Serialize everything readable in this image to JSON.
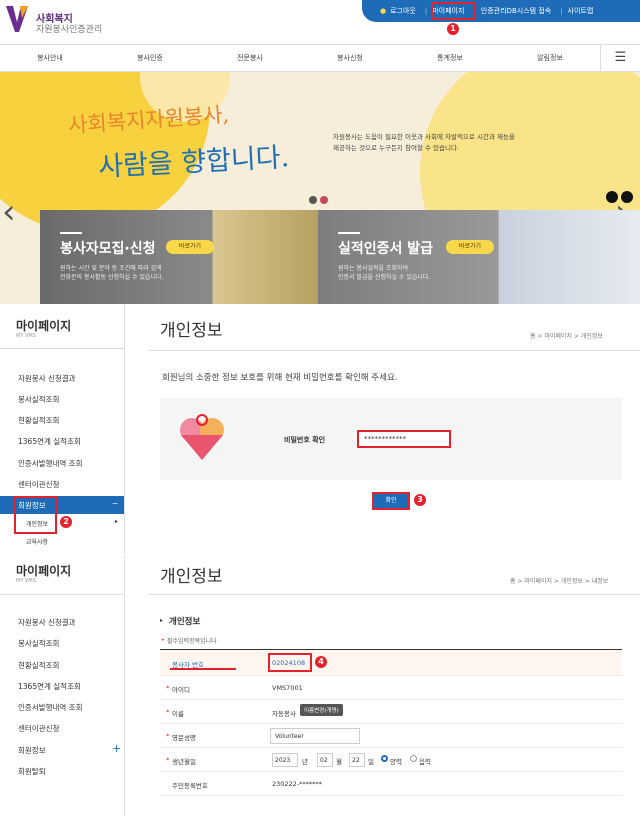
{
  "header": {
    "logo_line1": "사회복지",
    "logo_line2": "자원봉사인증관리",
    "util_links": {
      "logout": "로그아웃",
      "mypage": "마이페이지",
      "db": "인증관리DB시스템 접속",
      "sitemap": "사이트맵"
    }
  },
  "gnb": [
    "봉사안내",
    "봉사인증",
    "전문봉사",
    "봉사신청",
    "통계정보",
    "알림정보"
  ],
  "banner": {
    "title1": "사회복지자원봉사,",
    "title2": "사람을 향합니다.",
    "desc1": "자원봉사는 도움이 필요한 이웃과 사회에 자발적으로 시간과 재능을",
    "desc2": "제공하는 것으로 누구든지 참여할 수 있습니다."
  },
  "cards": [
    {
      "title": "봉사자모집·신청",
      "go": "바로가기",
      "desc1": "원하는 시간 및 분야 등 조건에 따라 검색",
      "desc2": "전화문의 봉사활동 신청하실 수 있습니다."
    },
    {
      "title": "실적인증서 발급",
      "go": "바로가기",
      "desc1": "원하는 봉사실적을 조회하여",
      "desc2": "인증서 발급을 신청하실 수 있습니다."
    }
  ],
  "section1": {
    "lnb_title": "마이페이지",
    "lnb_sub": "MY VMS",
    "lnb_items": [
      "자원봉사 신청결과",
      "봉사실적조회",
      "현황실적조회",
      "1365연계 실적조회",
      "인증서발행내역 조회",
      "센터이관신청",
      "회원정보"
    ],
    "lnb_active_minus": "−",
    "lnb_sub_items": [
      "개인정보",
      "교육사항"
    ],
    "page_title": "개인정보",
    "crumb": "홈  >  마이페이지  >  개인정보",
    "notice": "회원님의 소중한 정보 보호를 위해 현재 비밀번호를 확인해 주세요.",
    "pw_label": "비밀번호 확인",
    "pw_value": "************",
    "confirm": "확인",
    "badges": [
      "1",
      "2",
      "3",
      "4"
    ]
  },
  "section2": {
    "lnb_title": "마이페이지",
    "lnb_sub": "MY VMS",
    "lnb_items": [
      "자원봉사 신청결과",
      "봉사실적조회",
      "현황실적조회",
      "1365연계 실적조회",
      "인증서발행내역 조회",
      "센터이관신청",
      "회원정보",
      "회원탈퇴"
    ],
    "lnb_plus": "+",
    "page_title": "개인정보",
    "crumb": "홈  >  마이페이지  >  개인정보  >  내정보",
    "section_head": "개인정보",
    "required_note": "필수입력항목입니다",
    "rows": [
      {
        "label": "봉사자 번호",
        "value": "02024108"
      },
      {
        "label": "아이디",
        "value": "VMS7001"
      },
      {
        "label": "이름",
        "value": "자동봉사",
        "btn": "이름변경(개명)"
      },
      {
        "label": "영문성명",
        "value": "Volunteer"
      },
      {
        "label": "생년월일",
        "y": "2023",
        "ylabel": "년",
        "m": "02",
        "mlabel": "월",
        "d": "22",
        "dlabel": "일",
        "opt1": "양력",
        "opt2": "음력"
      },
      {
        "label": "주민등록번호",
        "value": "230222-*******"
      }
    ]
  },
  "colors": {
    "accent": "#1e6bb8",
    "red": "#e2222c",
    "yellow": "#f7c93a"
  }
}
